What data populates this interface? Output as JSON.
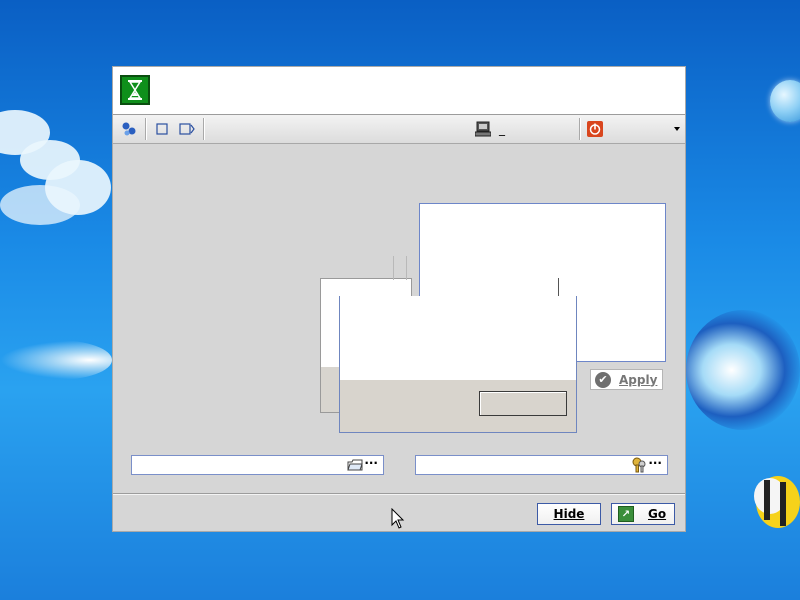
{
  "desktop": {
    "background_colors": [
      "#0a5fc4",
      "#2aa2f0"
    ]
  },
  "window": {
    "app_icon": "hourglass-icon",
    "toolbar": {
      "items": [
        {
          "icon": "network-icon"
        },
        {
          "icon": "square-icon"
        },
        {
          "icon": "view-forward-icon"
        },
        {
          "icon": "computer-icon",
          "label": "_"
        },
        {
          "icon": "power-icon"
        },
        {
          "icon": "dropdown-arrow-icon"
        }
      ]
    },
    "apply_button": {
      "label": "Apply",
      "icon": "check-circle-icon"
    },
    "fields": [
      {
        "value": "",
        "icon": "folder-icon",
        "browse": "···"
      },
      {
        "value": "",
        "icon": "keys-icon",
        "browse": "···"
      }
    ],
    "buttons": {
      "hide": "Hide",
      "go": "Go"
    }
  },
  "colors": {
    "window_bg": "#d6d6d6",
    "accent_border": "#3c5aa6",
    "app_icon_green": "#0f8f1b",
    "power_red": "#d9461e"
  }
}
